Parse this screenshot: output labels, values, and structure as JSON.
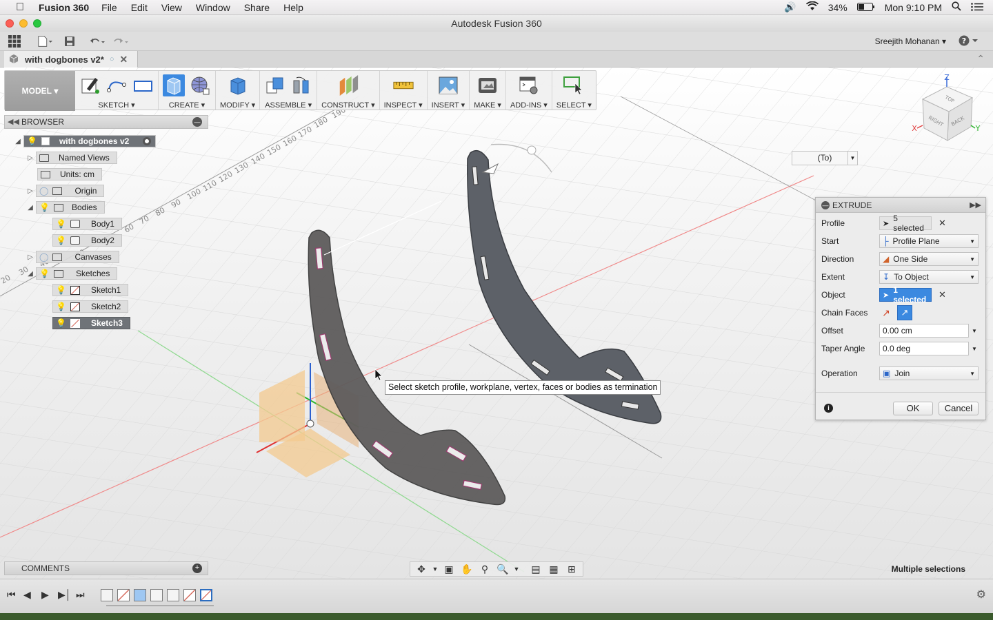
{
  "os_menu": {
    "app_name": "Fusion 360",
    "items": [
      "File",
      "Edit",
      "View",
      "Window",
      "Share",
      "Help"
    ],
    "battery": "34%",
    "clock": "Mon 9:10 PM"
  },
  "window": {
    "title": "Autodesk Fusion 360"
  },
  "quick_toolbar": {
    "user": "Sreejith Mohanan",
    "help": "?"
  },
  "document_tab": {
    "title": "with dogbones v2*"
  },
  "ribbon": {
    "workspace": "MODEL",
    "groups": [
      "SKETCH",
      "CREATE",
      "MODIFY",
      "ASSEMBLE",
      "CONSTRUCT",
      "INSPECT",
      "INSERT",
      "MAKE",
      "ADD-INS",
      "SELECT"
    ]
  },
  "browser": {
    "title": "BROWSER",
    "root": "with dogbones v2",
    "named_views": "Named Views",
    "units": "Units: cm",
    "origin": "Origin",
    "bodies": "Bodies",
    "body1": "Body1",
    "body2": "Body2",
    "canvases": "Canvases",
    "sketches": "Sketches",
    "sketch1": "Sketch1",
    "sketch2": "Sketch2",
    "sketch3": "Sketch3"
  },
  "viewport": {
    "to_dropdown": "(To)",
    "tooltip": "Select sketch profile, workplane, vertex, faces or bodies as termination",
    "ruler_ticks": [
      "190",
      "180",
      "170",
      "160",
      "150",
      "140",
      "130",
      "120",
      "110",
      "100",
      "90",
      "80",
      "70",
      "60",
      "50",
      "40",
      "30",
      "20"
    ],
    "viewcube": {
      "top": "TOP",
      "right": "RIGHT",
      "back": "BACK",
      "axis_x": "X",
      "axis_y": "Y",
      "axis_z": "Z"
    }
  },
  "extrude": {
    "title": "EXTRUDE",
    "profile_label": "Profile",
    "profile_value": "5 selected",
    "start_label": "Start",
    "start_value": "Profile Plane",
    "direction_label": "Direction",
    "direction_value": "One Side",
    "extent_label": "Extent",
    "extent_value": "To Object",
    "object_label": "Object",
    "object_value": "1 selected",
    "chain_label": "Chain Faces",
    "offset_label": "Offset",
    "offset_value": "0.00 cm",
    "taper_label": "Taper Angle",
    "taper_value": "0.0 deg",
    "operation_label": "Operation",
    "operation_value": "Join",
    "ok": "OK",
    "cancel": "Cancel"
  },
  "comments": {
    "title": "COMMENTS"
  },
  "status": {
    "text": "Multiple selections"
  },
  "colors": {
    "accent": "#3b89e0",
    "body_fill": "#5d6168",
    "plane_fill": "#f3c98f"
  }
}
